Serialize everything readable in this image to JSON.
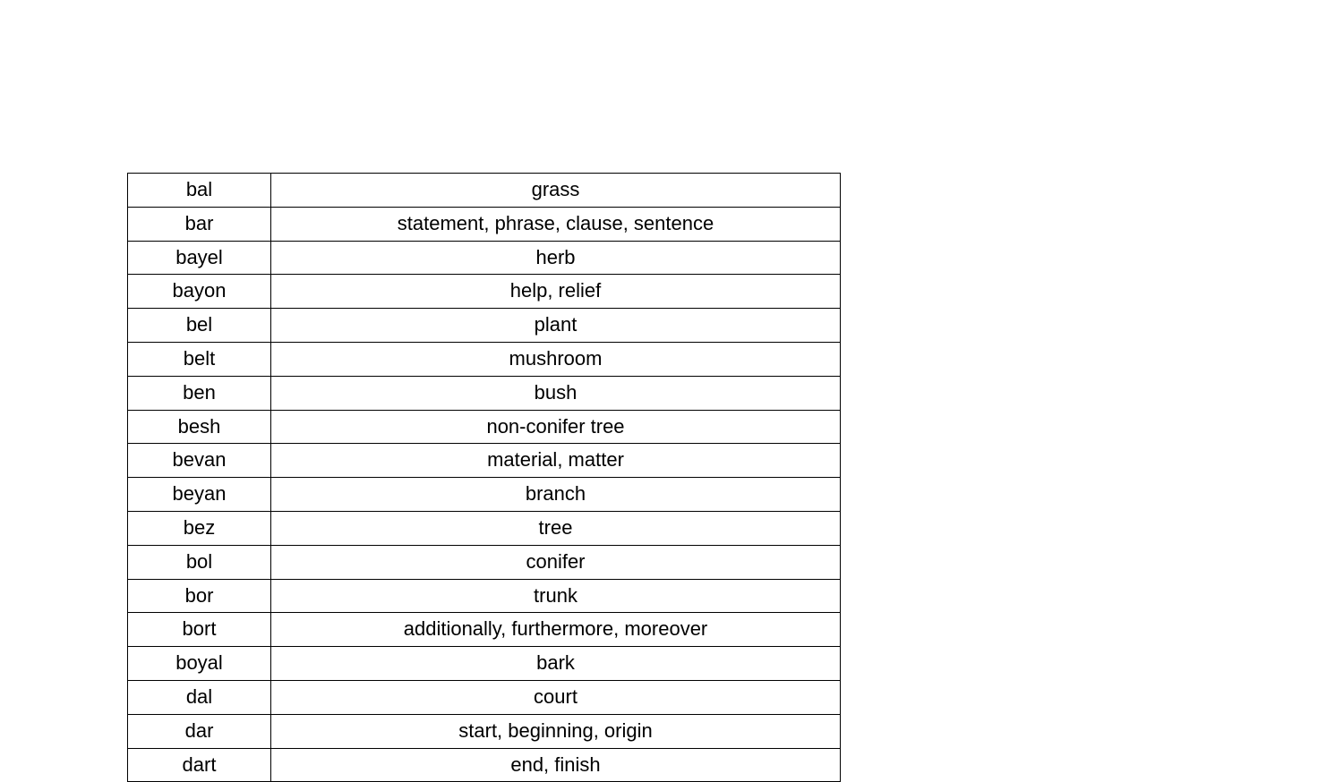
{
  "table": {
    "rows": [
      {
        "term": "bal",
        "definition": "grass"
      },
      {
        "term": "bar",
        "definition": "statement, phrase, clause, sentence"
      },
      {
        "term": "bayel",
        "definition": "herb"
      },
      {
        "term": "bayon",
        "definition": "help, relief"
      },
      {
        "term": "bel",
        "definition": "plant"
      },
      {
        "term": "belt",
        "definition": "mushroom"
      },
      {
        "term": "ben",
        "definition": "bush"
      },
      {
        "term": "besh",
        "definition": "non-conifer tree"
      },
      {
        "term": "bevan",
        "definition": "material, matter"
      },
      {
        "term": "beyan",
        "definition": "branch"
      },
      {
        "term": "bez",
        "definition": "tree"
      },
      {
        "term": "bol",
        "definition": "conifer"
      },
      {
        "term": "bor",
        "definition": "trunk"
      },
      {
        "term": "bort",
        "definition": "additionally, furthermore, moreover"
      },
      {
        "term": "boyal",
        "definition": "bark"
      },
      {
        "term": "dal",
        "definition": "court"
      },
      {
        "term": "dar",
        "definition": "start, beginning, origin"
      },
      {
        "term": "dart",
        "definition": "end, finish"
      }
    ]
  }
}
